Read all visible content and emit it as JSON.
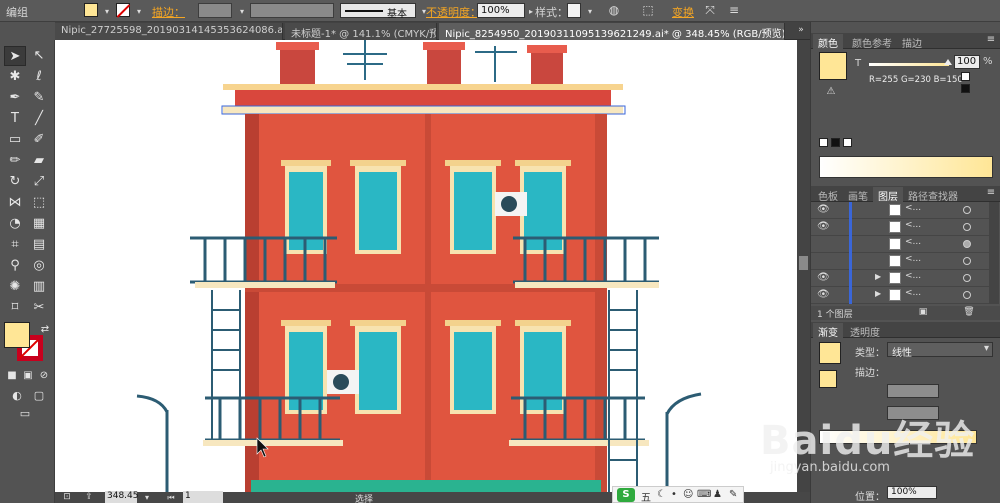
{
  "menubar": {
    "crumb": "编组"
  },
  "control_bar": {
    "stroke_label": "描边：",
    "stroke_style": "基本",
    "opacity_label": "不透明度：",
    "opacity_value": "100%",
    "style_label": "样式：",
    "transform_label": "变换",
    "colors": {
      "fill": "#ffe696",
      "stroke_none_red": "#dd0000",
      "link": "#f5a623"
    }
  },
  "tabs": [
    {
      "label": "Nipic_27725598_20190314145353624086.ai*",
      "close": "✕"
    },
    {
      "label": "未标题-1* @ 141.1% (CMYK/预...",
      "close": "✕"
    },
    {
      "label": "Nipic_8254950_20190311095139621249.ai* @ 348.45% (RGB/预览)",
      "close": "✕"
    }
  ],
  "status": {
    "zoom": "348.45",
    "page": "1",
    "mode": "选择"
  },
  "color_panel": {
    "tabs": [
      "颜色",
      "颜色参考",
      "描边"
    ],
    "channel": "T",
    "value": "100",
    "unit": "%",
    "rgb_readout": "R=255 G=230 B=150",
    "swatch": "#ffe696"
  },
  "layers_panel": {
    "tabs": [
      "色板",
      "画笔",
      "图层",
      "路径查找器"
    ],
    "rows": [
      {
        "name": "<...",
        "eye": true,
        "expand": false,
        "target": false
      },
      {
        "name": "<...",
        "eye": true,
        "expand": false,
        "target": false
      },
      {
        "name": "<...",
        "eye": false,
        "expand": false,
        "target": true
      },
      {
        "name": "<...",
        "eye": false,
        "expand": false,
        "target": false
      },
      {
        "name": "<...",
        "eye": true,
        "expand": true,
        "target": false
      },
      {
        "name": "<...",
        "eye": true,
        "expand": true,
        "target": false
      }
    ],
    "footer": "1 个图层"
  },
  "gradient_panel": {
    "tabs": [
      "渐变",
      "透明度"
    ],
    "type_label": "类型：",
    "type_value": "线性",
    "stroke_label": "描边：",
    "position_label": "位置：",
    "position_value": "100%"
  },
  "watermark": {
    "main": "Baidu经验",
    "sub": "jingyan.baidu.com"
  },
  "ime": {
    "logo": "S",
    "label": "五"
  },
  "icons": [
    "selection-arrow-icon",
    "direct-select-icon",
    "magic-wand-icon",
    "lasso-icon",
    "pen-icon",
    "curvature-icon",
    "type-icon",
    "line-icon",
    "rectangle-icon",
    "paintbrush-icon",
    "pencil-icon",
    "eraser-icon",
    "rotate-icon",
    "scale-icon",
    "width-icon",
    "free-transform-icon",
    "shape-builder-icon",
    "perspective-icon",
    "mesh-icon",
    "gradient-icon",
    "eyedropper-icon",
    "blend-icon",
    "symbol-sprayer-icon",
    "column-graph-icon",
    "artboard-icon",
    "slice-icon",
    "hand-icon",
    "zoom-icon"
  ]
}
